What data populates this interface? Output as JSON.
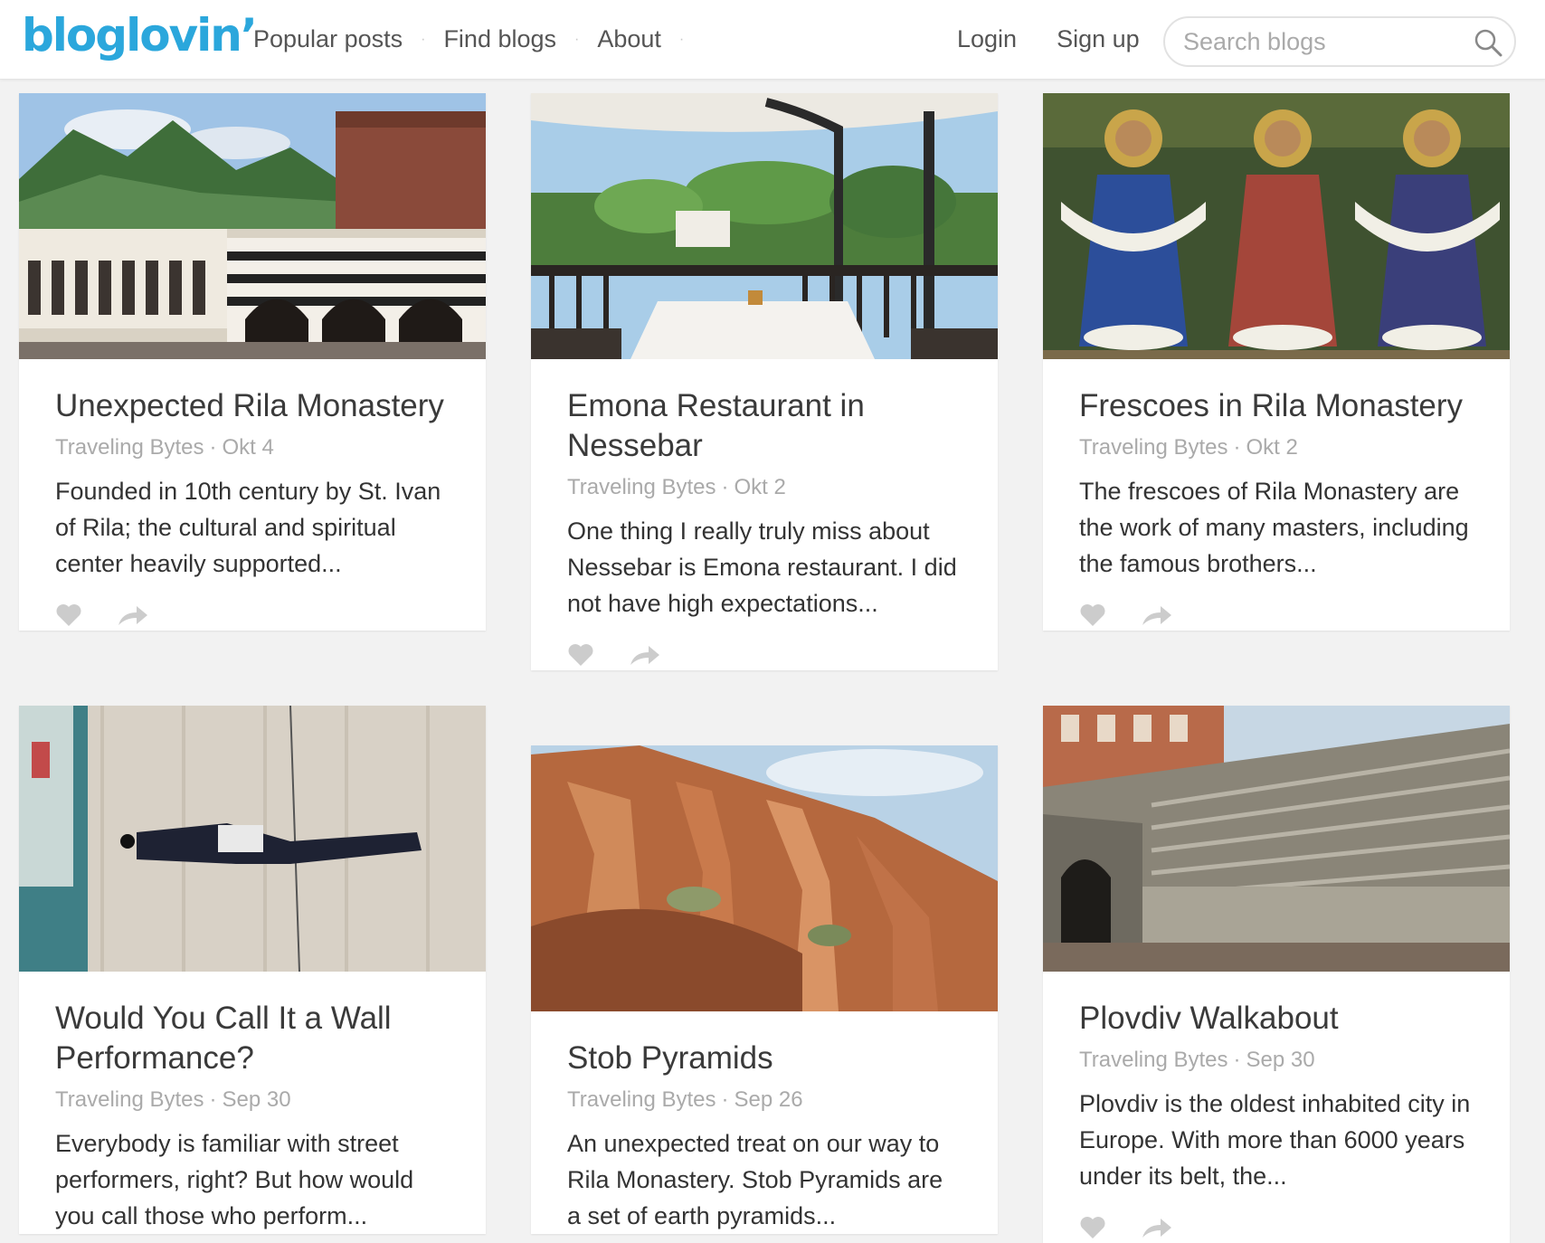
{
  "header": {
    "logo": "bloglovin’",
    "nav": [
      "Popular posts",
      "Find blogs",
      "About"
    ],
    "login": "Login",
    "signup": "Sign up",
    "search_placeholder": "Search blogs"
  },
  "posts": [
    {
      "title": "Unexpected Rila Monastery",
      "blog": "Traveling Bytes",
      "date": "Okt 4",
      "excerpt": "Founded in 10th century by St. Ivan of Rila; the cultural and spiritual center heavily supported...",
      "image": "monastery-courtyard-photo"
    },
    {
      "title": "Emona Restaurant in Nessebar",
      "blog": "Traveling Bytes",
      "date": "Okt 2",
      "excerpt": "One thing I really truly miss about Nessebar is Emona restaurant. I did not have high expectations...",
      "image": "restaurant-terrace-photo"
    },
    {
      "title": "Frescoes in Rila Monastery",
      "blog": "Traveling Bytes",
      "date": "Okt 2",
      "excerpt": "The frescoes of Rila Monastery are the work of many masters, including the famous brothers...",
      "image": "frescoes-photo"
    },
    {
      "title": "Would You Call It a Wall Performance?",
      "blog": "Traveling Bytes",
      "date": "Sep 30",
      "excerpt": "Everybody is familiar with street performers, right? But how would you call those who perform...",
      "image": "wall-performer-photo"
    },
    {
      "title": "Stob Pyramids",
      "blog": "Traveling Bytes",
      "date": "Sep 26",
      "excerpt": "An unexpected treat on our way to Rila Monastery. Stob Pyramids are a set of earth pyramids...",
      "image": "earth-pyramids-photo"
    },
    {
      "title": "Plovdiv Walkabout",
      "blog": "Traveling Bytes",
      "date": "Sep 30",
      "excerpt": "Plovdiv is the oldest inhabited city in Europe. With more than 6000 years under its belt, the...",
      "image": "roman-theatre-photo"
    }
  ],
  "colors": {
    "brand": "#2ba7dc",
    "page_background": "#f2f2f2",
    "meta_text": "#aaaaaa",
    "action_icon": "#cccccc"
  }
}
